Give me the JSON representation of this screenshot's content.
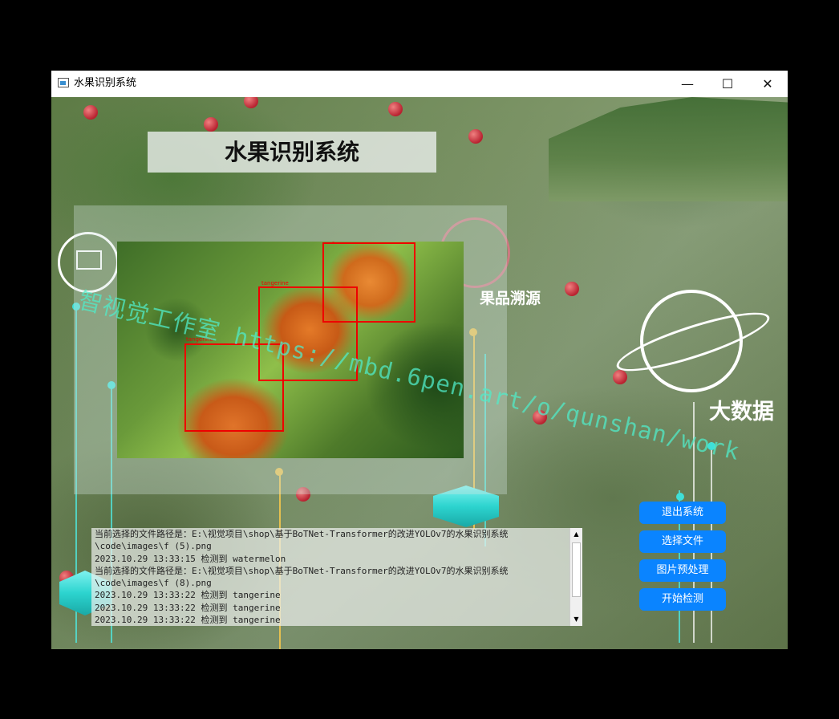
{
  "window": {
    "title": "水果识别系统",
    "controls": {
      "minimize": "—",
      "maximize": "☐",
      "close": "✕"
    }
  },
  "header": {
    "title": "水果识别系统"
  },
  "decor": {
    "trace_label": "果品溯源",
    "bigdata_label": "大数据",
    "watermark": "智视觉工作室 https://mbd.6pen.art/o/qunshan/work"
  },
  "detections": [
    {
      "label": "tangerine"
    },
    {
      "label": "tangerine"
    },
    {
      "label": "tangerine"
    }
  ],
  "log": {
    "lines": [
      "当前选择的文件路径是：E:\\视觉项目\\shop\\基于BoTNet-Transformer的改进YOLOv7的水果识别系统",
      "\\code\\images\\f (5).png",
      "2023.10.29 13:33:15  检测到 watermelon",
      "当前选择的文件路径是：E:\\视觉项目\\shop\\基于BoTNet-Transformer的改进YOLOv7的水果识别系统",
      "\\code\\images\\f (8).png",
      "2023.10.29 13:33:22  检测到 tangerine",
      "2023.10.29 13:33:22  检测到 tangerine",
      "2023.10.29 13:33:22  检测到 tangerine"
    ]
  },
  "actions": {
    "exit": "退出系统",
    "select_file": "选择文件",
    "preprocess": "图片预处理",
    "start_detect": "开始检测"
  },
  "colors": {
    "button": "#0a84ff",
    "bbox": "#ee0000",
    "accent": "#3fe0d8"
  }
}
